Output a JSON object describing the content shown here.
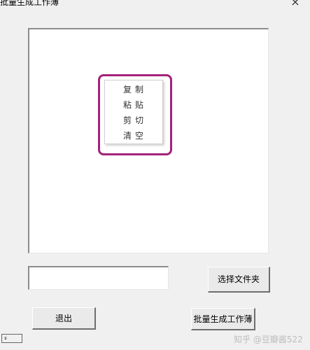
{
  "window": {
    "title": "批量生成工作薄",
    "close_symbol": "×"
  },
  "context_menu": {
    "items": [
      {
        "label": "复制"
      },
      {
        "label": "粘贴"
      },
      {
        "label": "剪切"
      },
      {
        "label": "清空"
      }
    ],
    "highlight_color": "#a3237a"
  },
  "folder_path_input": {
    "value": ""
  },
  "buttons": {
    "select_folder": "选择文件夹",
    "exit": "退出",
    "batch_generate": "批量生成工作薄"
  },
  "status_box": {
    "text": "ะ"
  },
  "watermark": "知乎 @豆瓣酱522"
}
